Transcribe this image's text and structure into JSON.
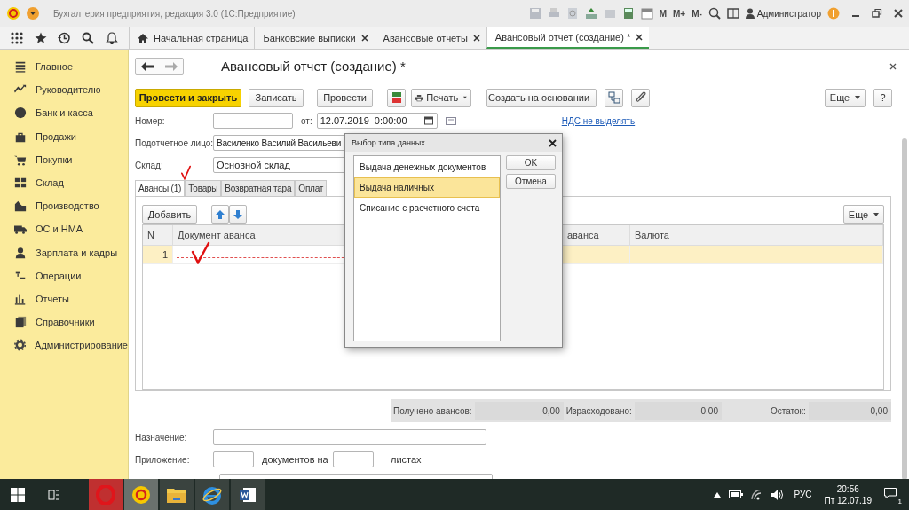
{
  "app_bar": {
    "title": "Бухгалтерия предприятия, редакция 3.0  (1С:Предприятие)",
    "memory_buttons": [
      "M",
      "M+",
      "M-"
    ],
    "user": "Администратор"
  },
  "open_tabs": [
    {
      "label": "Начальная страница",
      "selected": false,
      "kind": "home"
    },
    {
      "label": "Банковские выписки",
      "selected": false,
      "kind": "doc"
    },
    {
      "label": "Авансовые отчеты",
      "selected": false,
      "kind": "doc"
    },
    {
      "label": "Авансовый отчет (создание) *",
      "selected": true,
      "kind": "doc"
    }
  ],
  "sidebar": {
    "items": [
      {
        "label": "Главное"
      },
      {
        "label": "Руководителю"
      },
      {
        "label": "Банк и касса"
      },
      {
        "label": "Продажи"
      },
      {
        "label": "Покупки"
      },
      {
        "label": "Склад"
      },
      {
        "label": "Производство"
      },
      {
        "label": "ОС и НМА"
      },
      {
        "label": "Зарплата и кадры"
      },
      {
        "label": "Операции"
      },
      {
        "label": "Отчеты"
      },
      {
        "label": "Справочники"
      },
      {
        "label": "Администрирование"
      }
    ]
  },
  "form": {
    "title": "Авансовый отчет (создание) *",
    "toolbar": {
      "post_close": "Провести и закрыть",
      "save": "Записать",
      "post": "Провести",
      "print": "Печать",
      "create_based": "Создать на основании",
      "more": "Еще",
      "help": "?"
    },
    "number_label": "Номер:",
    "date_label": "от:",
    "date": "12.07.2019  0:00:00",
    "vat_link": "НДС не выделять",
    "person": {
      "label": "Подотчетное лицо:",
      "value": "Василенко Василий Васильеви"
    },
    "warehouse": {
      "label": "Склад:",
      "value": "Основной склад"
    },
    "tabs": [
      {
        "label": "Авансы (1)",
        "selected": true
      },
      {
        "label": "Товары",
        "selected": false
      },
      {
        "label": "Возвратная тара",
        "selected": false
      },
      {
        "label": "Оплат",
        "selected": false
      }
    ],
    "table": {
      "add": "Добавить",
      "more": "Еще",
      "columns": [
        "N",
        "Документ аванса",
        "аванса",
        "Валюта"
      ],
      "rows": [
        {
          "n": "1",
          "selected": true,
          "required": true
        }
      ]
    },
    "totals": [
      {
        "label": "Получено авансов:",
        "value": "0,00"
      },
      {
        "label": "Израсходовано:",
        "value": "0,00"
      },
      {
        "label": "Остаток:",
        "value": "0,00"
      }
    ],
    "purpose_label": "Назначение:",
    "attachment": {
      "label": "Приложение:",
      "docs": "документов на",
      "sheets": "листах"
    }
  },
  "dialog": {
    "title": "Выбор типа данных",
    "items": [
      {
        "label": "Выдача денежных документов",
        "selected": false
      },
      {
        "label": "Выдача наличных",
        "selected": true
      },
      {
        "label": "Списание с расчетного счета",
        "selected": false
      }
    ],
    "ok": "OK",
    "cancel": "Отмена"
  },
  "taskbar": {
    "lang": "РУС",
    "time": "20:56",
    "date": "Пт 12.07.19",
    "notifications": "1"
  }
}
